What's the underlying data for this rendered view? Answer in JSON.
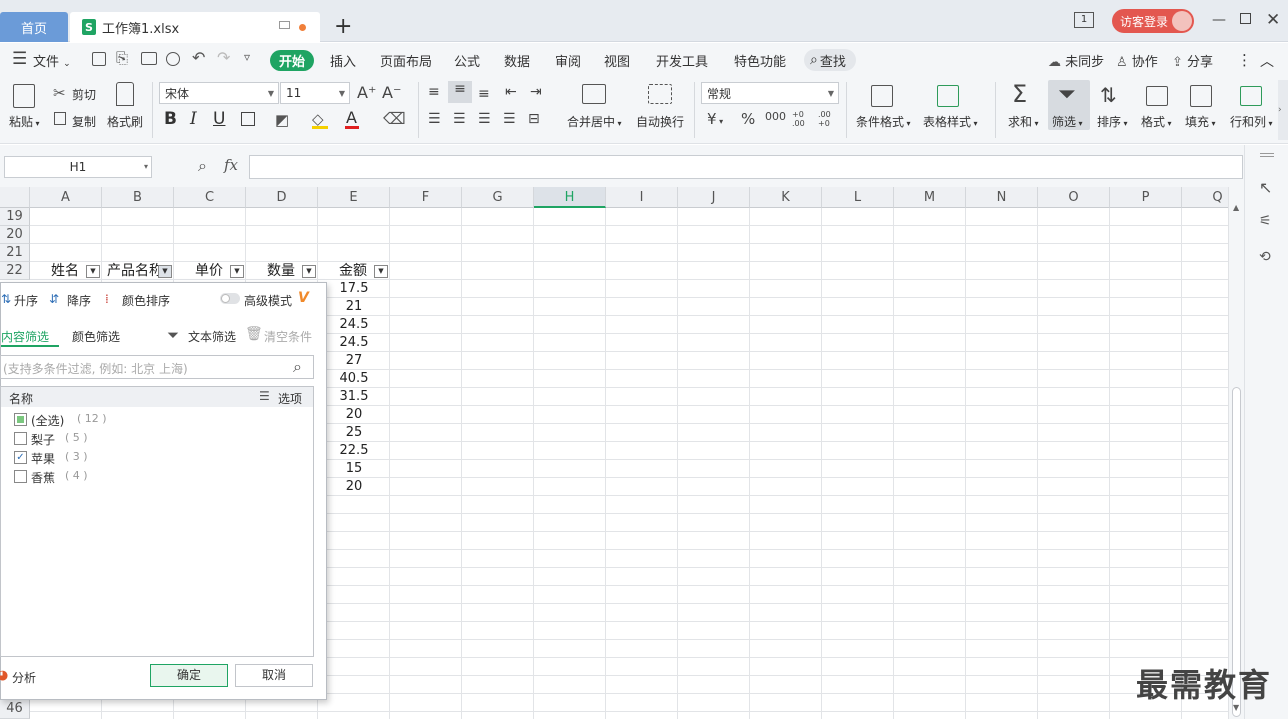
{
  "titlebar": {
    "home_tab": "首页",
    "file_tab": "工作簿1.xlsx",
    "file_icon": "S",
    "new_tab": "+",
    "login": "访客登录",
    "page_count": "1"
  },
  "menu": {
    "file": "文件",
    "items": [
      "开始",
      "插入",
      "页面布局",
      "公式",
      "数据",
      "审阅",
      "视图",
      "开发工具",
      "特色功能"
    ],
    "search": "查找",
    "sync": "未同步",
    "collab": "协作",
    "share": "分享"
  },
  "ribbon": {
    "paste": "粘贴",
    "cut": "剪切",
    "copy": "复制",
    "format_painter": "格式刷",
    "font_name": "宋体",
    "font_size": "11",
    "bold": "B",
    "italic": "I",
    "underline": "U",
    "merge": "合并居中",
    "wrap": "自动换行",
    "number_format": "常规",
    "currency": "¥",
    "percent": "%",
    "thousand": "000",
    "dec_inc": "+0 .00",
    "dec_dec": ".00 +0",
    "cond_format": "条件格式",
    "table_style": "表格样式",
    "sum": "求和",
    "filter": "筛选",
    "sort": "排序",
    "format": "格式",
    "fill": "填充",
    "row_col": "行和列"
  },
  "formula": {
    "name_box": "H1",
    "fx": "fx",
    "value": ""
  },
  "grid": {
    "columns": [
      "A",
      "B",
      "C",
      "D",
      "E",
      "F",
      "G",
      "H",
      "I",
      "J",
      "K",
      "L",
      "M",
      "N",
      "O",
      "P",
      "Q"
    ],
    "selected_column": "H",
    "row_numbers": [
      "19",
      "20",
      "21",
      "22"
    ],
    "last_row": "46",
    "headers": [
      "姓名",
      "产品名称",
      "单价",
      "数量",
      "金额"
    ],
    "amounts": [
      "17.5",
      "21",
      "24.5",
      "24.5",
      "27",
      "40.5",
      "31.5",
      "20",
      "25",
      "22.5",
      "15",
      "20"
    ]
  },
  "filter_popup": {
    "asc": "升序",
    "desc": "降序",
    "color_sort": "颜色排序",
    "advanced": "高级模式",
    "tab_content": "内容筛选",
    "tab_color": "颜色筛选",
    "text_filter": "文本筛选",
    "clear": "清空条件",
    "search_placeholder": "(支持多条件过滤, 例如: 北京  上海)",
    "list_header": "名称",
    "options": "选项",
    "items": [
      {
        "label": "(全选)",
        "count": "( 12 )",
        "checked": "partial"
      },
      {
        "label": "梨子",
        "count": "( 5 )",
        "checked": "false"
      },
      {
        "label": "苹果",
        "count": "( 3 )",
        "checked": "true"
      },
      {
        "label": "香蕉",
        "count": "( 4 )",
        "checked": "false"
      }
    ],
    "analysis": "分析",
    "ok": "确定",
    "cancel": "取消"
  },
  "watermark": "最需教育",
  "colors": {
    "accent": "#1fa463",
    "home_tab": "#6b9bd8",
    "login": "#e3574f"
  }
}
